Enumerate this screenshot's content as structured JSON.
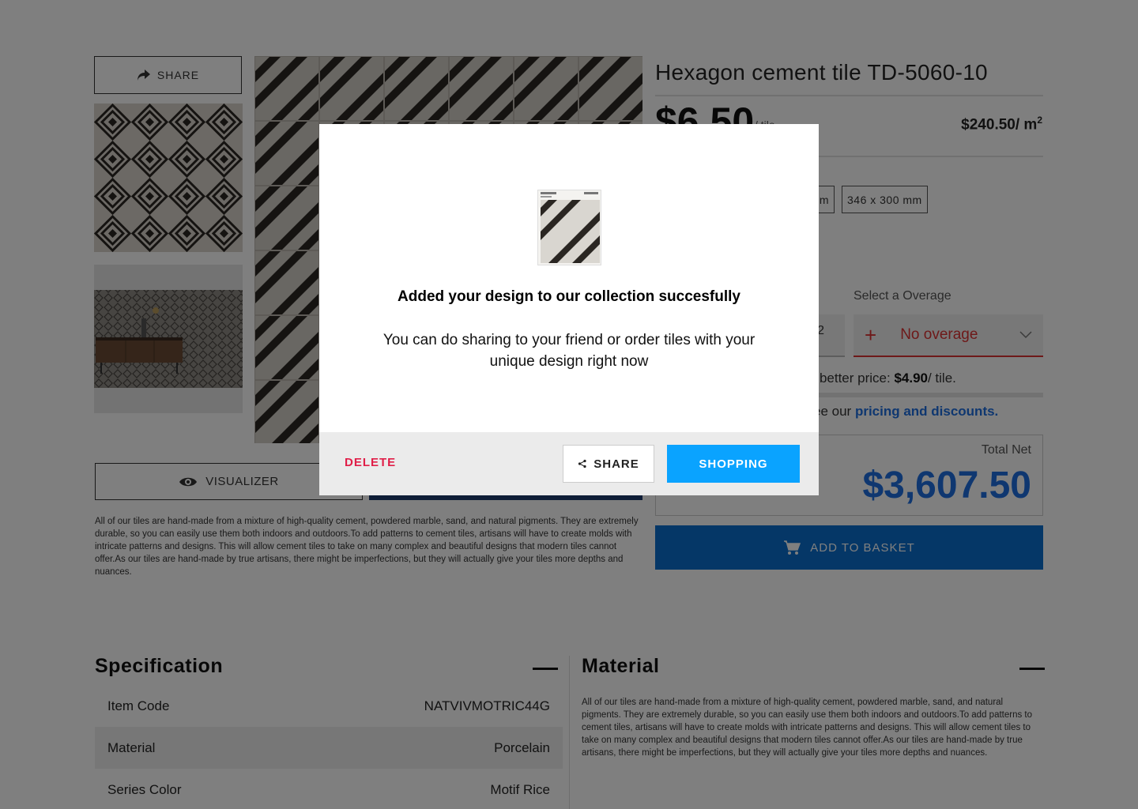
{
  "product": {
    "title": "Hexagon cement tile TD-5060-10",
    "price": "$6.50",
    "price_unit": "/ tile",
    "price_m2": "$240.50/ m",
    "price_m2_sup": "2",
    "sizes": [
      "m",
      "346 x 300 mm"
    ],
    "share_label": "SHARE",
    "visualizer_label": "VISUALIZER",
    "description": "All of our tiles are hand-made from a mixture of high-quality cement, powdered marble, sand, and natural pigments. They are extremely durable, so you can easily use them both indoors and outdoors.To add patterns to cement tiles, artisans will have to create molds with intricate patterns and designs. This will allow cement tiles to take on many complex and beautiful designs that modern tiles cannot offer.As our tiles are hand-made by true artisans, there might be imperfections, but they will actually give your tiles more depths and nuances."
  },
  "order": {
    "overage_label": "Select a Overage",
    "quantity_value": "2",
    "overage_value": "No overage",
    "better_price_prefix": "xt better price: ",
    "better_price_value": "$4.90",
    "better_price_suffix": "/ tile.",
    "progress_fraction": 0.1,
    "pricing_prefix": "ee our ",
    "pricing_link": "pricing and discounts.",
    "total_label": "Total Net",
    "total_value": "$3,607.50",
    "basket_label": "ADD TO BASKET"
  },
  "specification": {
    "title": "Specification",
    "rows": [
      {
        "label": "Item Code",
        "value": "NATVIVMOTRIC44G"
      },
      {
        "label": "Material",
        "value": "Porcelain"
      },
      {
        "label": "Series Color",
        "value": "Motif Rice"
      }
    ]
  },
  "material": {
    "title": "Material",
    "description": "All of our tiles are hand-made from a mixture of high-quality cement, powdered marble, sand, and natural pigments. They are extremely durable, so you can easily use them both indoors and outdoors.To add patterns to cement tiles, artisans will have to create molds with intricate patterns and designs. This will allow cement tiles to take on many complex and beautiful designs that modern tiles cannot offer.As our tiles are hand-made by true artisans, there might be imperfections, but they will actually give your tiles more depths and nuances."
  },
  "modal": {
    "title": "Added your design to our collection succesfully",
    "text": "You can do sharing to your friend or order tiles with your unique design right now",
    "delete_label": "DELETE",
    "share_label": "SHARE",
    "shopping_label": "SHOPPING"
  },
  "colors": {
    "accent_blue": "#1e6fe0",
    "shopping_blue": "#0aa3ff",
    "delete_red": "#e01e48",
    "overage_red": "#d33"
  }
}
